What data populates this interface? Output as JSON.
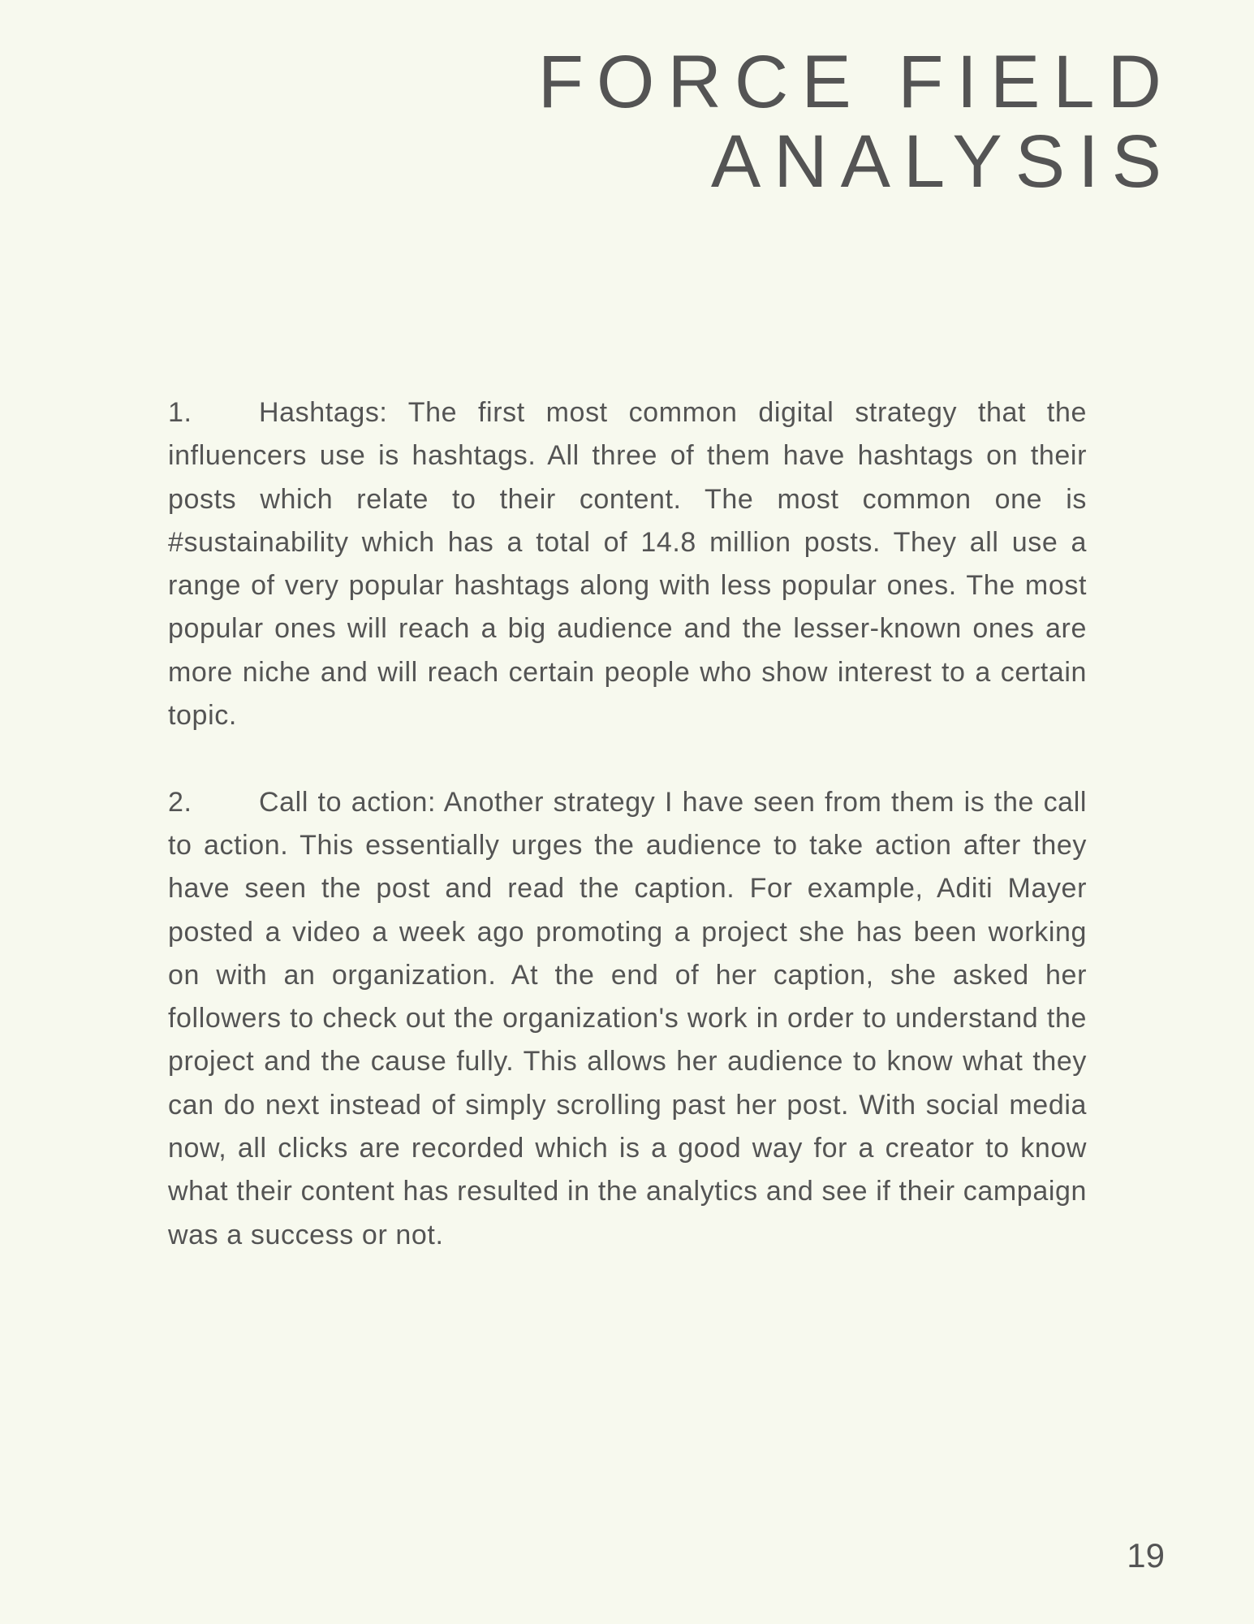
{
  "title": {
    "line1": "FORCE FIELD",
    "line2": "ANALYSIS"
  },
  "paragraphs": [
    {
      "number": "1.",
      "text": "Hashtags: The first most common digital strategy that the influencers use is hashtags. All three of them have hashtags on their posts which relate to their content. The most common one is #sustainability which has a total of 14.8 million posts. They all use a range of very popular hashtags along with less popular ones. The most popular ones will reach a big audience and the lesser-known ones are more niche and will reach certain people who show interest to a certain topic."
    },
    {
      "number": "2.",
      "text": "Call to action: Another strategy I have seen from them is the call to action. This essentially urges the audience to take action after they have seen the post and read the caption. For example, Aditi Mayer posted a video a week ago promoting a project she has been working on with an organization. At the end of her caption, she asked her followers to check out the organization's work in order to understand the project and the cause fully. This allows her audience to know what they can do next instead of simply scrolling past her post. With social media now, all clicks are recorded which is a good way for a creator to know what their content has resulted in the analytics and see if their campaign was a success or not."
    }
  ],
  "page_number": "19"
}
